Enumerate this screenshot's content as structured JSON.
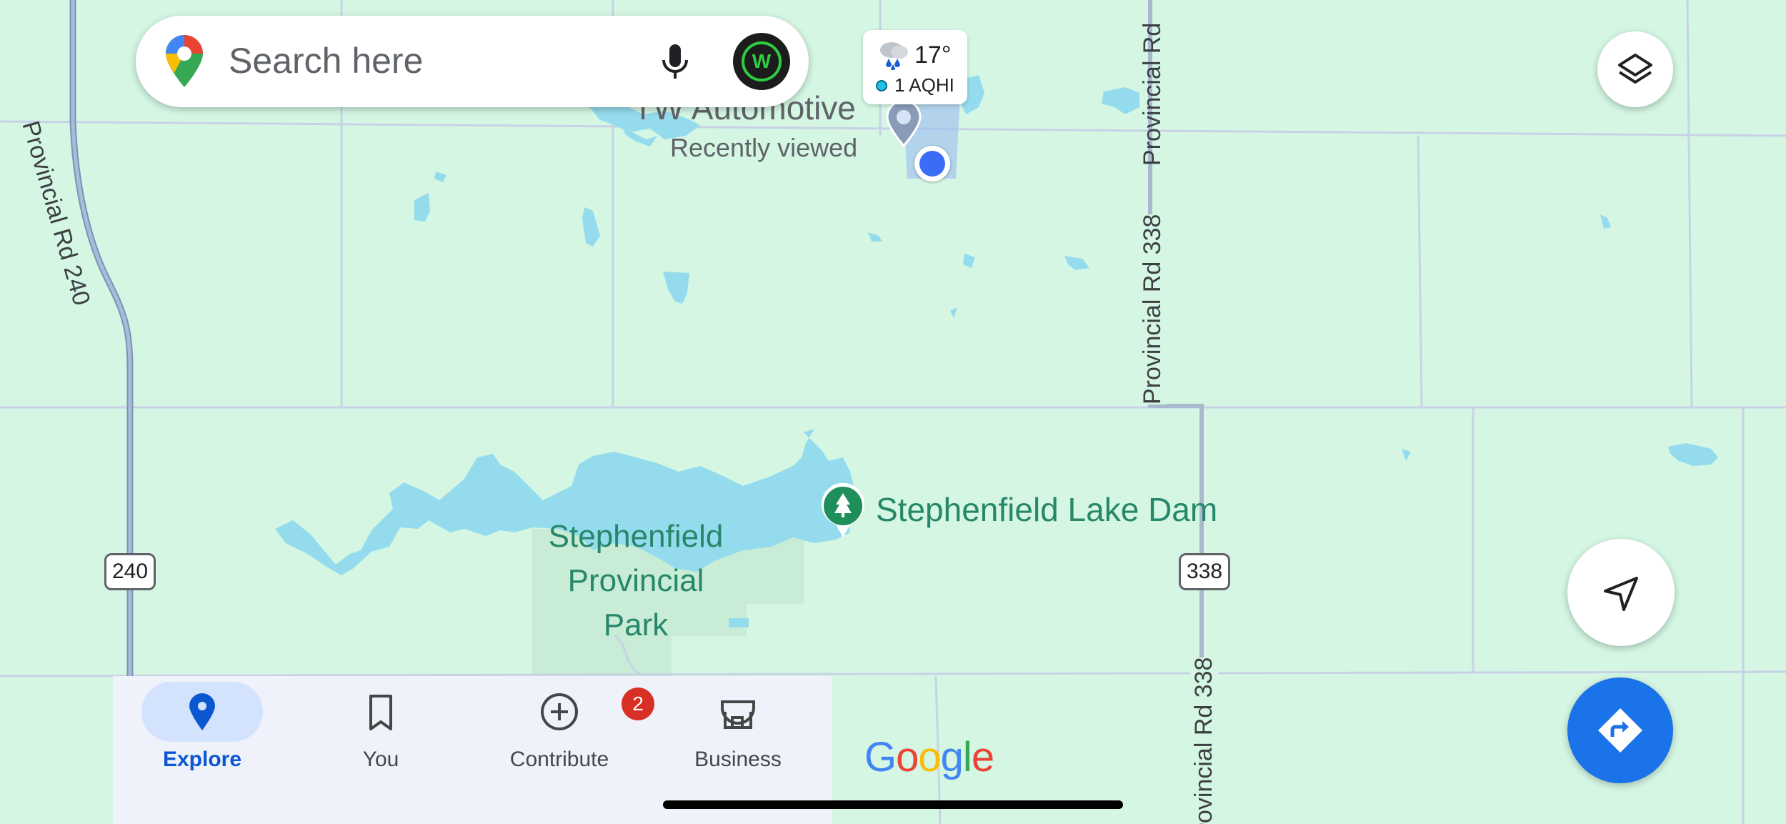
{
  "search": {
    "placeholder": "Search here"
  },
  "weather": {
    "temperature": "17°",
    "aqi": "1 AQHI"
  },
  "map": {
    "places": {
      "recent_place": "TW Automotive",
      "recent_place_sub": "Recently viewed",
      "park_line1": "Stephenfield",
      "park_line2": "Provincial",
      "park_line3": "Park",
      "dam": "Stephenfield Lake Dam"
    },
    "roads": {
      "rd240": "Provincial Rd 240",
      "rd338_top": "Provincial Rd",
      "rd338_mid": "Provincial Rd 338",
      "rd338_bottom": "ovincial Rd 338",
      "shield_240": "240",
      "shield_338": "338"
    }
  },
  "bottom_nav": {
    "items": [
      {
        "label": "Explore",
        "icon": "pin-icon",
        "active": true
      },
      {
        "label": "You",
        "icon": "bookmark-icon",
        "active": false
      },
      {
        "label": "Contribute",
        "icon": "add-circle-icon",
        "active": false
      },
      {
        "label": "Business",
        "icon": "storefront-icon",
        "active": false
      }
    ],
    "business_badge": "2"
  },
  "branding": {
    "g1": "G",
    "o1": "o",
    "o2": "o",
    "g2": "g",
    "l": "l",
    "e": "e"
  },
  "colors": {
    "land": "#d4f6e3",
    "water": "#94dced",
    "road": "#c5cfe2",
    "park_text": "#188038",
    "accent": "#1a73e8"
  }
}
